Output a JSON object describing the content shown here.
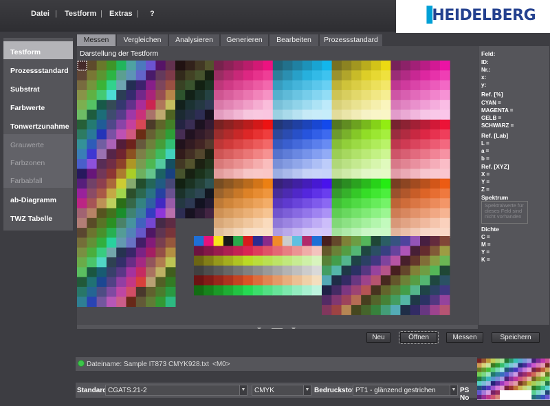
{
  "menu": [
    "Datei",
    "Testform",
    "Extras",
    "?"
  ],
  "logo": "HEIDELBERG",
  "sidebar": {
    "items": [
      {
        "label": "Testform",
        "state": "selected"
      },
      {
        "label": "Prozessstandard",
        "state": "normal"
      },
      {
        "label": "Substrat",
        "state": "normal"
      },
      {
        "label": "Farbwerte",
        "state": "normal"
      },
      {
        "label": "Tonwertzunahme",
        "state": "normal"
      },
      {
        "label": "Grauwerte",
        "state": "disabled"
      },
      {
        "label": "Farbzonen",
        "state": "disabled"
      },
      {
        "label": "Farbabfall",
        "state": "disabled"
      },
      {
        "label": "ab-Diagramm",
        "state": "normal"
      },
      {
        "label": "TWZ Tabelle",
        "state": "normal"
      }
    ]
  },
  "tabs": [
    "Messen",
    "Vergleichen",
    "Analysieren",
    "Generieren",
    "Bearbeiten",
    "Prozessstandard"
  ],
  "active_tab": "Messen",
  "panel_title": "Darstellung der Testform",
  "info": {
    "feld": "Feld:",
    "id": "ID:",
    "nr": "Nr.:",
    "x": "x:",
    "y": "y:",
    "ref_pct": "Ref. [%]",
    "cyan": "CYAN =",
    "magenta": "MAGENTA =",
    "gelb": "GELB =",
    "schwarz": "SCHWARZ =",
    "ref_lab": "Ref. [Lab]",
    "L": "L =",
    "a": "a =",
    "b": "b =",
    "ref_xyz": "Ref. [XYZ]",
    "X": "X =",
    "Y": "Y =",
    "Z": "Z =",
    "spektrum": "Spektrum",
    "spektrum_note": "Spektralwerte für dieses Feld sind nicht vorhanden",
    "dichte": "Dichte",
    "C": "C =",
    "M": "M =",
    "Yd": "Y =",
    "K": "K ="
  },
  "buttons": {
    "neu": "Neu",
    "offnen": "Öffnen",
    "messen": "Messen",
    "speichern": "Speichern"
  },
  "file": {
    "name": "Dateiname: Sample IT873 CMYK928.txt",
    "marker": "<M0>"
  },
  "bottom": {
    "standard_label": "Standard",
    "standard_value": "CGATS.21-2",
    "colorspace_value": "CMYK",
    "bedruckstoff_label": "Bedruckstoff",
    "bedruckstoff_value": "PT1 - glänzend gestrichen",
    "ps_label": "PS No"
  },
  "colors": {
    "accent_green": "#3cc64a",
    "logo_blue": "#24418f",
    "logo_cyan": "#00a0d6"
  },
  "icons": {
    "status": "status-dot-icon",
    "dropdown": "dropdown-arrow-icon",
    "splitter": "splitter-grip-icon"
  }
}
